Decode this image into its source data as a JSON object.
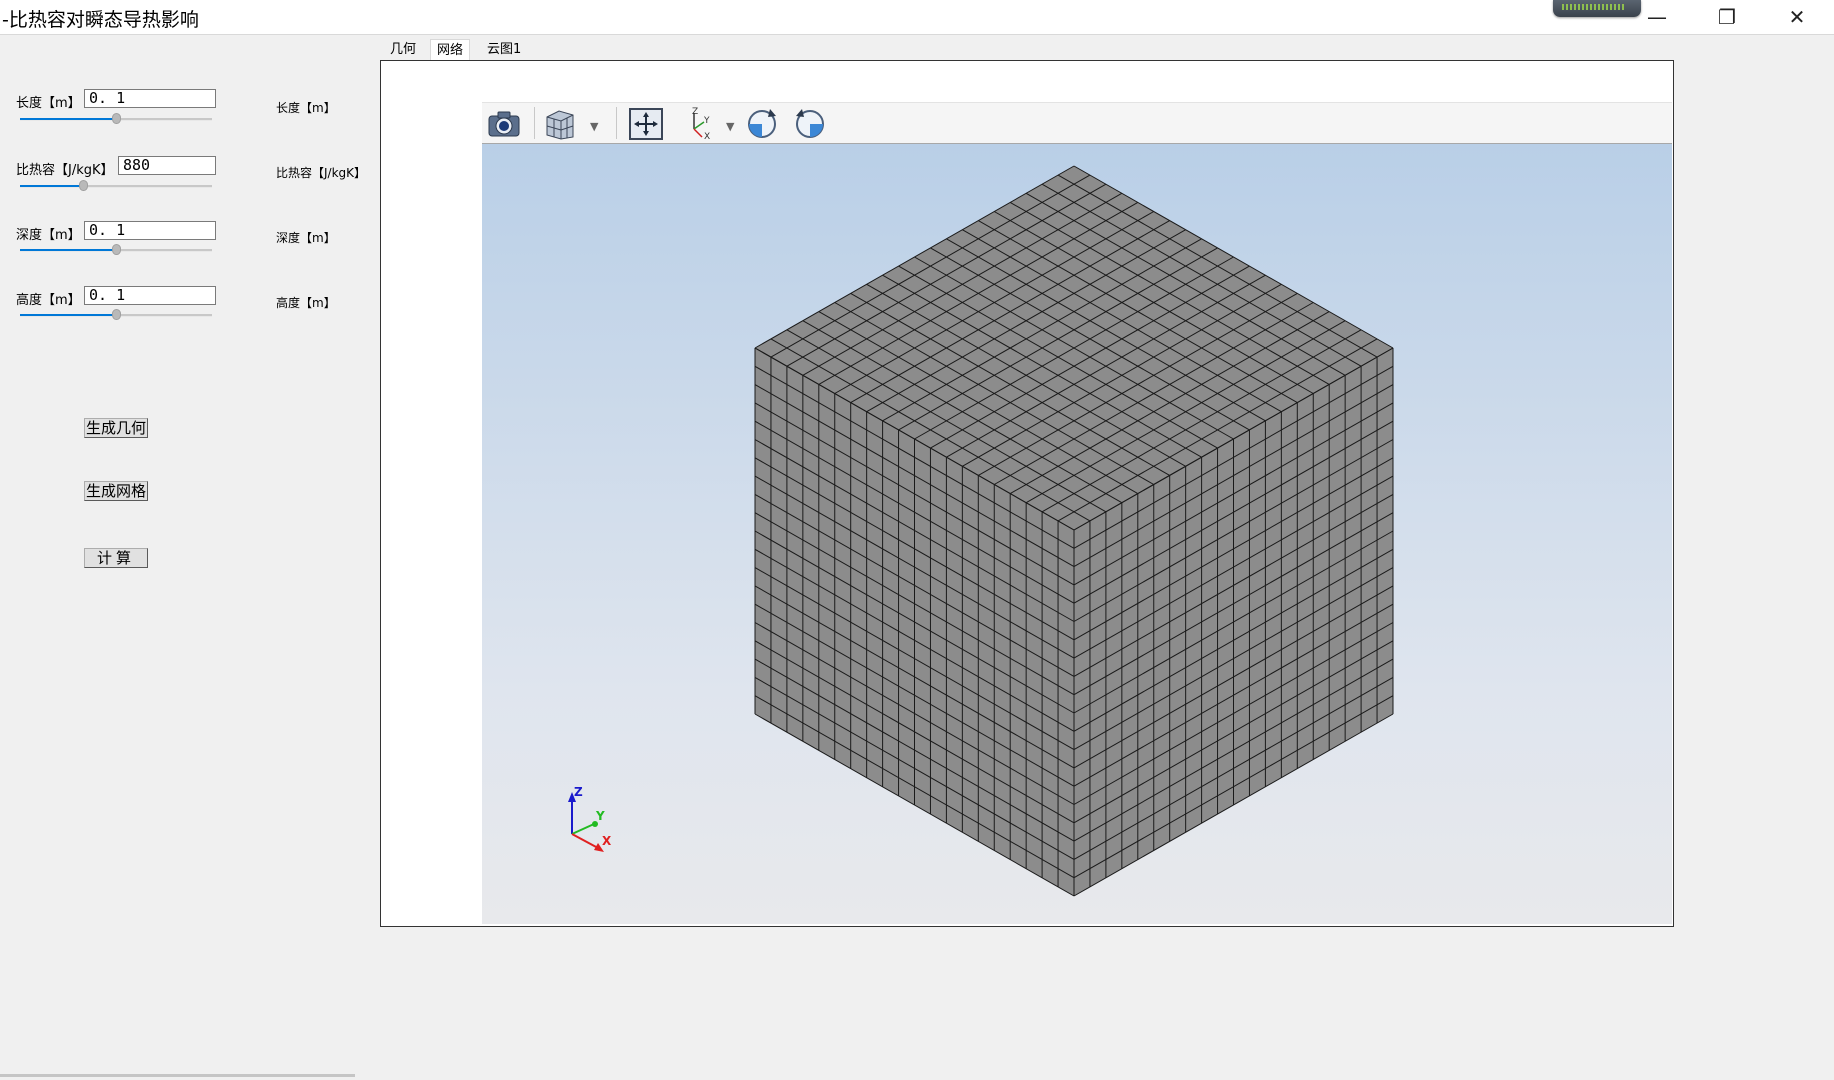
{
  "window": {
    "title": "-比热容对瞬态导热影响",
    "minimize_glyph": "—",
    "restore_glyph": "❐",
    "close_glyph": "✕"
  },
  "params": [
    {
      "label": "长度【m】",
      "value": "0. 1",
      "level": 0.5,
      "readout_label": "长度【m】"
    },
    {
      "label": "比热容【J/kgK】",
      "value": "880",
      "level": 0.33,
      "readout_label": "比热容【J/kgK】"
    },
    {
      "label": "深度【m】",
      "value": "0. 1",
      "level": 0.5,
      "readout_label": "深度【m】"
    },
    {
      "label": "高度【m】",
      "value": "0. 1",
      "level": 0.5,
      "readout_label": "高度【m】"
    }
  ],
  "buttons": {
    "geometry": "生成几何",
    "mesh": "生成网格",
    "compute": "计算"
  },
  "tabs": [
    {
      "label": "几何",
      "active": false
    },
    {
      "label": "网络",
      "active": true
    },
    {
      "label": "云图1",
      "active": false
    }
  ],
  "toolbar": {
    "icons": [
      "camera-icon",
      "view-cube-icon",
      "fit-view-icon",
      "axes-icon",
      "rotate-cw-icon",
      "rotate-ccw-icon"
    ]
  },
  "viewport": {
    "mesh_divisions": 20,
    "mesh_face_color": "#8c8c8c",
    "mesh_line_color": "#1a1a1a",
    "background_top": "#b9cfe7",
    "background_bottom": "#e8e9ec",
    "triad": {
      "x": "X",
      "y": "Y",
      "z": "Z",
      "x_color": "#e02020",
      "y_color": "#22bb22",
      "z_color": "#1a1acc"
    }
  }
}
